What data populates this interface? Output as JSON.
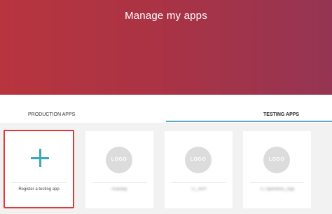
{
  "header": {
    "title": "Manage my apps"
  },
  "tabs": [
    {
      "label": "PRODUCTION APPS",
      "active": false
    },
    {
      "label": "TESTING APPS",
      "active": true
    }
  ],
  "register_card": {
    "label": "Register a testing app",
    "icon": "plus-icon"
  },
  "apps": [
    {
      "logo_text": "LOGO",
      "name": "Aranday"
    },
    {
      "logo_text": "LOGO",
      "name": "TL_APP"
    },
    {
      "logo_text": "LOGO",
      "name": "TL Openlines_App"
    }
  ],
  "colors": {
    "hero_gradient_start": "#b8343f",
    "hero_gradient_end": "#953553",
    "accent": "#3aa9b8",
    "tab_underline": "#5aa9c9",
    "highlight_border": "#e03a3a"
  }
}
